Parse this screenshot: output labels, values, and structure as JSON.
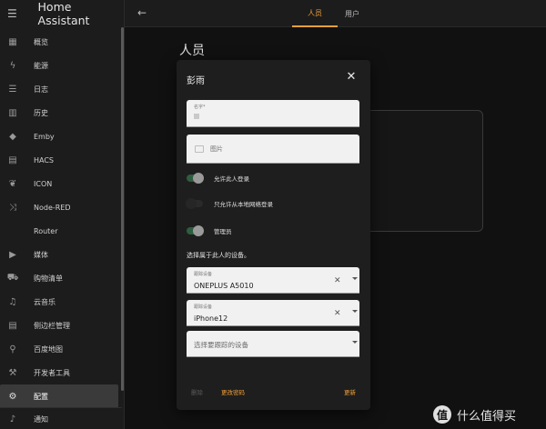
{
  "app": {
    "title": "Home Assistant"
  },
  "sidebar": {
    "items": [
      {
        "label": "概览",
        "icon": "dashboard-icon"
      },
      {
        "label": "能源",
        "icon": "lightning-icon"
      },
      {
        "label": "日志",
        "icon": "list-icon"
      },
      {
        "label": "历史",
        "icon": "chart-icon"
      },
      {
        "label": "Emby",
        "icon": "emby-icon"
      },
      {
        "label": "HACS",
        "icon": "hacs-icon"
      },
      {
        "label": "ICON",
        "icon": "leaf-icon"
      },
      {
        "label": "Node-RED",
        "icon": "sitemap-icon"
      },
      {
        "label": "Router",
        "icon": "router-icon"
      },
      {
        "label": "媒体",
        "icon": "play-box-icon"
      },
      {
        "label": "购物清单",
        "icon": "cart-icon"
      },
      {
        "label": "云音乐",
        "icon": "music-icon"
      },
      {
        "label": "侧边栏管理",
        "icon": "table-icon"
      },
      {
        "label": "百度地图",
        "icon": "map-pin-icon"
      },
      {
        "label": "开发者工具",
        "icon": "hammer-icon"
      },
      {
        "label": "配置",
        "icon": "gear-icon"
      }
    ],
    "active_index": 15,
    "bottom": {
      "label": "通知",
      "icon": "bell-icon"
    }
  },
  "topbar": {
    "tabs": [
      {
        "label": "人员",
        "active": true
      },
      {
        "label": "用户",
        "active": false
      }
    ]
  },
  "main": {
    "title": "人员"
  },
  "dialog": {
    "title": "彭雨",
    "name_field_label": "名字*",
    "picture_label": "图片",
    "toggles": [
      {
        "label": "允许此人登录",
        "on": true
      },
      {
        "label": "只允许从本地网络登录",
        "on": false
      },
      {
        "label": "管理员",
        "on": true
      }
    ],
    "devices_section_label": "选择属于此人的设备。",
    "devices": [
      {
        "label": "跟踪设备",
        "value": "ONEPLUS A5010"
      },
      {
        "label": "跟踪设备",
        "value": "iPhone12"
      }
    ],
    "device_placeholder": "选择要跟踪的设备",
    "actions": {
      "delete": "删除",
      "change_password": "更改密码",
      "update": "更新"
    }
  },
  "watermark": {
    "text": "什么值得买",
    "logo_char": "值"
  },
  "colors": {
    "accent": "#f2a038",
    "toggle_on": "#2d5e3e",
    "background": "#111111",
    "dialog_bg": "#1e1e1e"
  }
}
